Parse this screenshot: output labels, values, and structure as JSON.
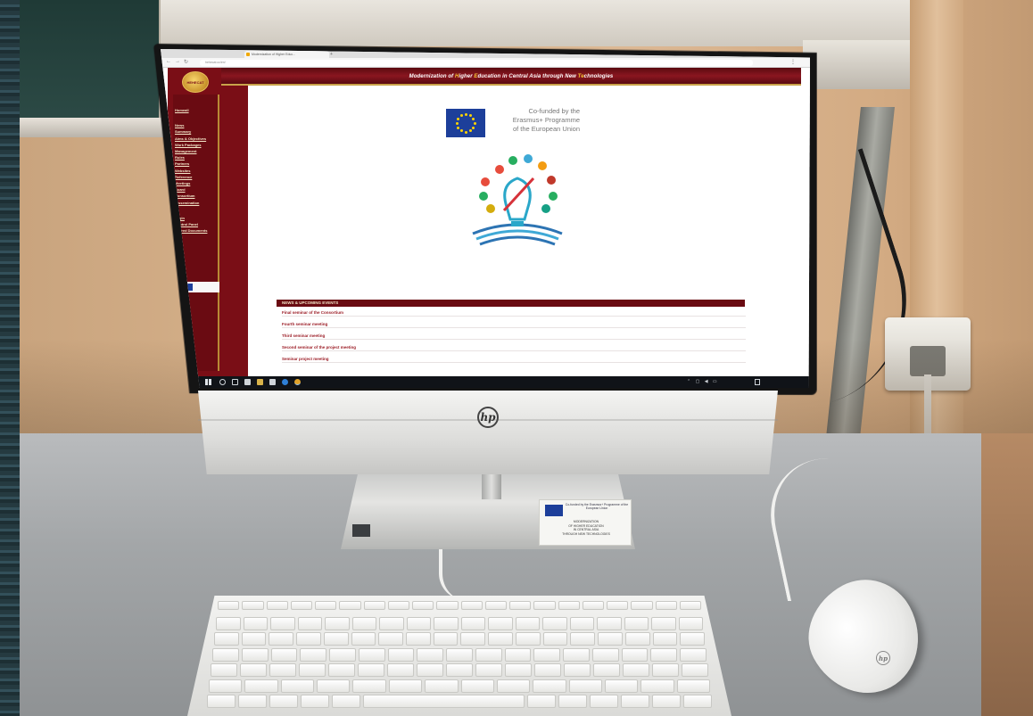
{
  "browser": {
    "tab_title": "Modernization of Higher Educ...",
    "new_tab": "+",
    "url": "hehecat.cc/en/",
    "menu": "⋮"
  },
  "site": {
    "logo_text": "HEHECAT",
    "banner": {
      "part1": "Modernization of ",
      "h1": "H",
      "part2": "igher ",
      "h2": "E",
      "part3": "ducation in Central Asia through New ",
      "h3": "Te",
      "part4": "chnologies"
    },
    "nav": [
      "Homeall",
      "News",
      "Summary",
      "Aims & Objectives",
      "Work Packages",
      "Management",
      "Rules",
      "Partners",
      "Websites",
      "Reference",
      "Meetings",
      "Board",
      "Consortium",
      "Dissemination",
      "Login",
      "Control Panel",
      "Shared Documents"
    ],
    "eu_text": [
      "Co-funded by the",
      "Erasmus+ Programme",
      "of the European Union"
    ],
    "news_heading": "NEWS & UPCOMING EVENTS",
    "news": [
      {
        "title": "Final seminar of the Consortium",
        "date": "",
        "text": ""
      },
      {
        "title": "Fourth seminar meeting",
        "date": "",
        "text": ""
      },
      {
        "title": "Third seminar meeting",
        "date": "",
        "text": ""
      },
      {
        "title": "Second seminar of the project meeting",
        "date": "",
        "text": ""
      },
      {
        "title": "Seminar project meeting",
        "date": "",
        "text": ""
      }
    ]
  },
  "taskbar": {
    "tray": "⌃ ▢ ◀ ▭",
    "time": "",
    "date": ""
  },
  "monitor": {
    "brand": "hp"
  },
  "mouse": {
    "brand": "hp"
  },
  "sticker": {
    "heading": "Co-funded by the Erasmus+ Programme of the European Union",
    "lines": [
      "MODERNIZATION",
      "OF HIGHER EDUCATION",
      "IN CENTRAL ASIA",
      "THROUGH NEW TECHNOLOGIES"
    ]
  },
  "colors": {
    "site_maroon": "#7a0e16",
    "site_gold": "#f2c230",
    "eu_blue": "#1d3f9a"
  }
}
